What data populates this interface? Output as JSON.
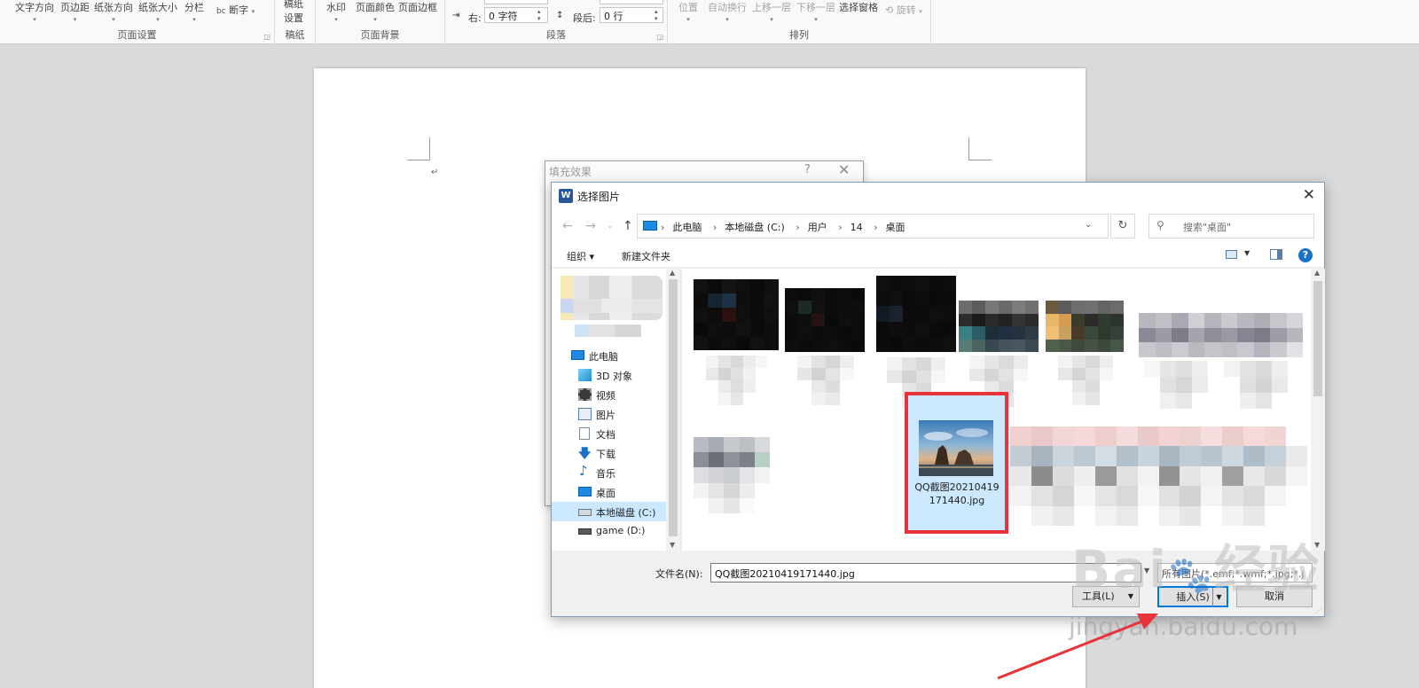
{
  "ribbon": {
    "page_setup": {
      "title": "页面设置",
      "buttons": [
        "文字方向",
        "页边距",
        "纸张方向",
        "纸张大小",
        "分栏"
      ],
      "hyphenation": "断字"
    },
    "draft": {
      "title": "稿纸",
      "button": "稿纸\n设置"
    },
    "background": {
      "title": "页面背景",
      "buttons": [
        "水印",
        "页面颜色",
        "页面边框"
      ]
    },
    "paragraph": {
      "title": "段落",
      "indent_right_label": "右:",
      "indent_right_value": "0 字符",
      "space_after_label": "段后:",
      "space_after_value": "0 行"
    },
    "arrange": {
      "title": "排列",
      "buttons": [
        "位置",
        "自动换行",
        "上移一层",
        "下移一层",
        "选择窗格"
      ],
      "rotate": "旋转"
    }
  },
  "fill_dialog": {
    "title": "填充效果",
    "help": "?",
    "close": "✕"
  },
  "dialog": {
    "title": "选择图片",
    "close": "✕",
    "breadcrumbs": [
      "此电脑",
      "本地磁盘 (C:)",
      "用户",
      "14",
      "桌面"
    ],
    "search_placeholder": "搜索\"桌面\"",
    "toolbar": {
      "organize": "组织 ▾",
      "new_folder": "新建文件夹"
    },
    "sidebar": [
      {
        "label": "此电脑",
        "icon": "computer-icon"
      },
      {
        "label": "3D 对象",
        "icon": "cube-icon"
      },
      {
        "label": "视频",
        "icon": "video-icon"
      },
      {
        "label": "图片",
        "icon": "picture-icon"
      },
      {
        "label": "文档",
        "icon": "document-icon"
      },
      {
        "label": "下载",
        "icon": "download-icon"
      },
      {
        "label": "音乐",
        "icon": "music-icon"
      },
      {
        "label": "桌面",
        "icon": "desktop-icon"
      },
      {
        "label": "本地磁盘 (C:)",
        "icon": "drive-icon"
      },
      {
        "label": "game (D:)",
        "icon": "drive-icon"
      }
    ],
    "selected_file": {
      "name": "QQ截图20210419171440.jpg"
    },
    "filename_label": "文件名(N):",
    "filename_value": "QQ截图20210419171440.jpg",
    "filter_value": "所有图片(*.emf;*.wmf;*.jpg;*.j",
    "tools_label": "工具(L)",
    "insert_label": "插入(S)",
    "cancel_label": "取消"
  },
  "watermark": {
    "logo": "Bai du 经验",
    "url": "jingyan.baidu.com"
  },
  "colors": {
    "highlight": "#e8333a",
    "selection": "#cce8ff",
    "accent": "#0078d7"
  }
}
